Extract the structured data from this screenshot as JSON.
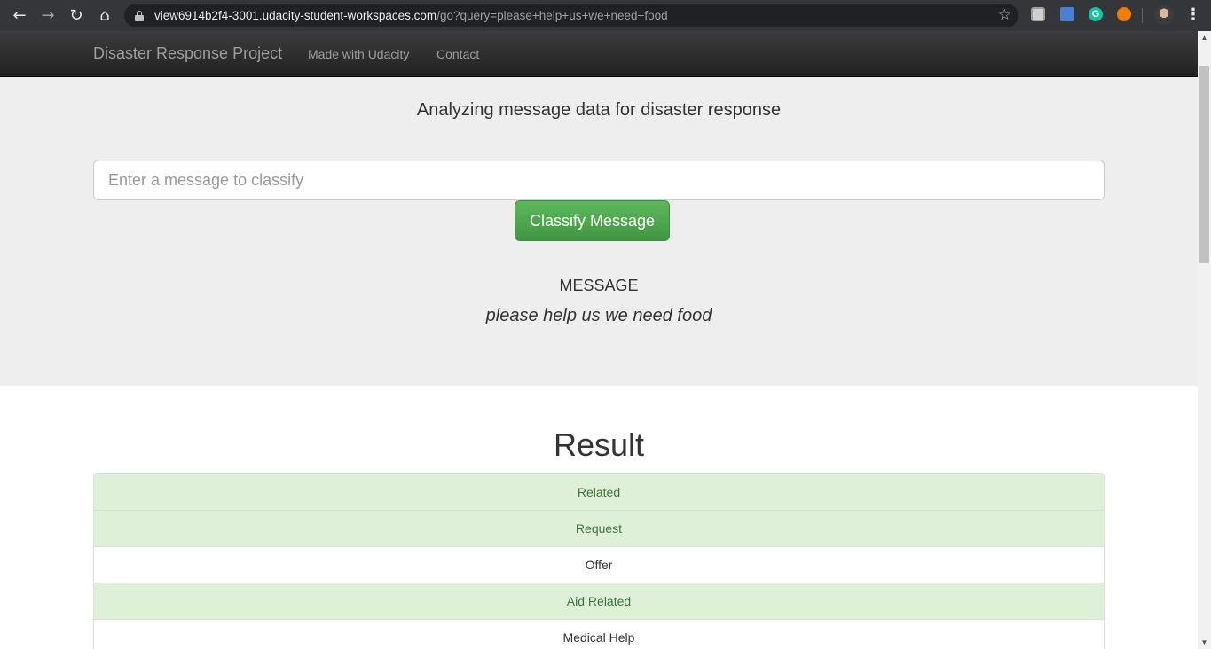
{
  "browser": {
    "url_host": "view6914b2f4-3001.udacity-student-workspaces.com",
    "url_path": "/go?query=please+help+us+we+need+food",
    "extension_icons": [
      "print-icon",
      "bookmark-ext-icon",
      "grammarly-icon",
      "extension-icon"
    ],
    "grammarly_letter": "G"
  },
  "navbar": {
    "brand": "Disaster Response Project",
    "links": [
      "Made with Udacity",
      "Contact"
    ]
  },
  "header": {
    "subtitle": "Analyzing message data for disaster response"
  },
  "form": {
    "placeholder": "Enter a message to classify",
    "button_label": "Classify Message"
  },
  "message": {
    "label": "MESSAGE",
    "text": "please help us we need food"
  },
  "result": {
    "title": "Result",
    "items": [
      {
        "label": "Related",
        "positive": true
      },
      {
        "label": "Request",
        "positive": true
      },
      {
        "label": "Offer",
        "positive": false
      },
      {
        "label": "Aid Related",
        "positive": true
      },
      {
        "label": "Medical Help",
        "positive": false
      }
    ]
  },
  "colors": {
    "positive_bg": "#dff0d8",
    "positive_text": "#3c763d",
    "button": "#5cb85c"
  }
}
